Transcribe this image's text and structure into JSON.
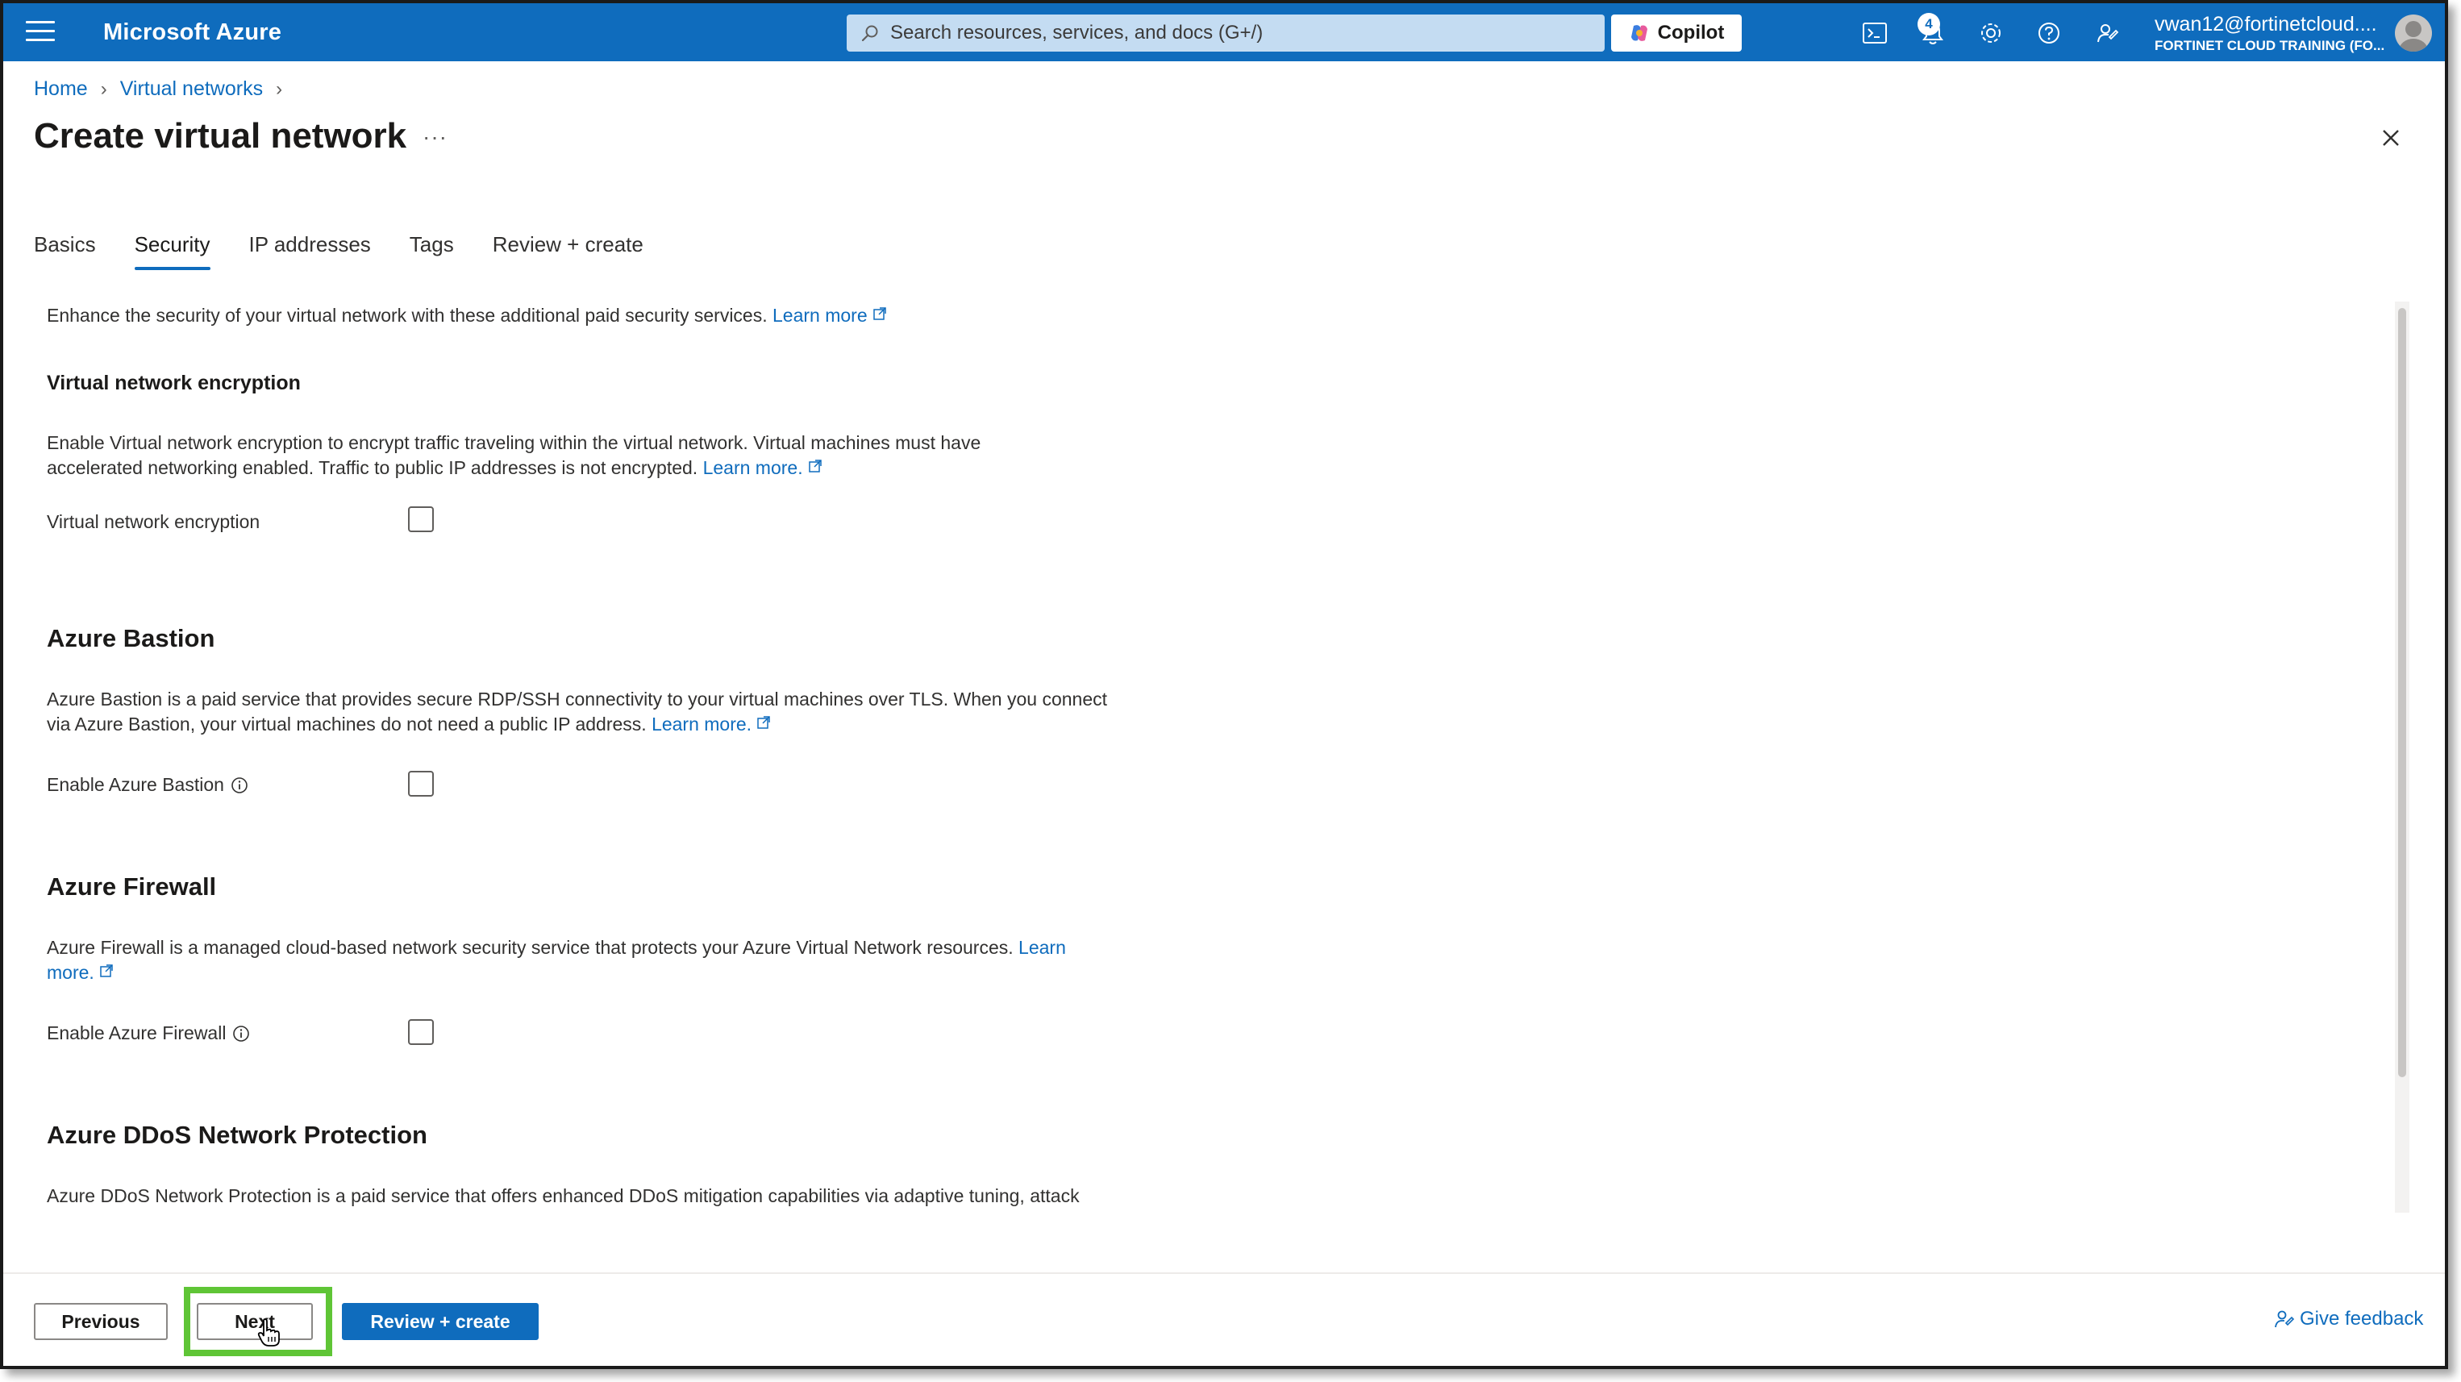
{
  "topbar": {
    "brand": "Microsoft Azure",
    "search_placeholder": "Search resources, services, and docs (G+/)",
    "copilot_label": "Copilot",
    "notification_count": "4",
    "account_user": "vwan12@fortinetcloud....",
    "account_directory": "FORTINET CLOUD TRAINING (FO...",
    "brand_color": "#0f6cbd"
  },
  "breadcrumb": {
    "home": "Home",
    "virtual_networks": "Virtual networks"
  },
  "page": {
    "title": "Create virtual network",
    "more": "···"
  },
  "tabs": [
    {
      "label": "Basics"
    },
    {
      "label": "Security",
      "active": true
    },
    {
      "label": "IP addresses"
    },
    {
      "label": "Tags"
    },
    {
      "label": "Review + create"
    }
  ],
  "security": {
    "intro": "Enhance the security of your virtual network with these additional paid security services.",
    "intro_link": "Learn more",
    "encryption": {
      "heading": "Virtual network encryption",
      "desc_line1": "Enable Virtual network encryption to encrypt traffic traveling within the virtual network. Virtual machines must have",
      "desc_line2": "accelerated networking enabled. Traffic to public IP addresses is not encrypted.",
      "link": "Learn more.",
      "field_label": "Virtual network encryption",
      "checked": false
    },
    "bastion": {
      "heading": "Azure Bastion",
      "desc_line1": "Azure Bastion is a paid service that provides secure RDP/SSH connectivity to your virtual machines over TLS. When you connect",
      "desc_line2": "via Azure Bastion, your virtual machines do not need a public IP address.",
      "link": "Learn more.",
      "field_label": "Enable Azure Bastion",
      "checked": false
    },
    "firewall": {
      "heading": "Azure Firewall",
      "desc_line1": "Azure Firewall is a managed cloud-based network security service that protects your Azure Virtual Network resources.",
      "link_part1": "Learn",
      "link_part2": "more.",
      "field_label": "Enable Azure Firewall",
      "checked": false
    },
    "ddos": {
      "heading": "Azure DDoS Network Protection",
      "desc_line1": "Azure DDoS Network Protection is a paid service that offers enhanced DDoS mitigation capabilities via adaptive tuning, attack"
    }
  },
  "footer": {
    "previous": "Previous",
    "next": "Next",
    "review_create": "Review + create",
    "feedback": "Give feedback",
    "highlight_color": "#5fc536"
  }
}
